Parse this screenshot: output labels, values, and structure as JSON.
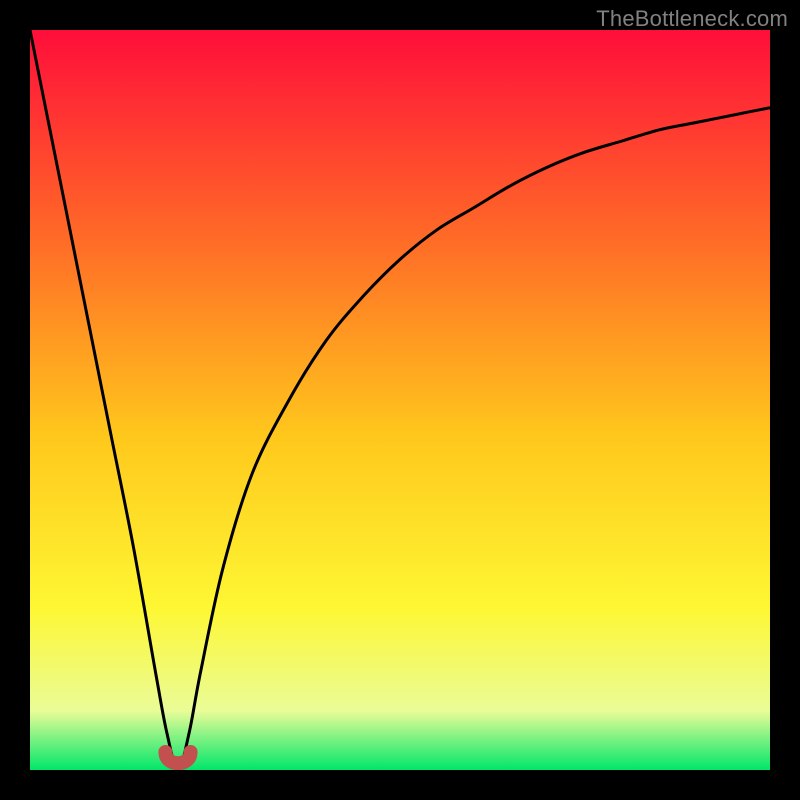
{
  "watermark": "TheBottleneck.com",
  "colors": {
    "frame": "#000000",
    "gradient_top": "#ff0e3a",
    "gradient_mid1": "#ff6a27",
    "gradient_mid2": "#ffc81c",
    "gradient_mid3": "#fef733",
    "gradient_mid4": "#eafc97",
    "gradient_bottom": "#00e66a",
    "curve": "#000000",
    "marker": "#c1504e"
  },
  "chart_data": {
    "type": "line",
    "title": "",
    "xlabel": "",
    "ylabel": "",
    "xlim": [
      0,
      100
    ],
    "ylim": [
      0,
      100
    ],
    "note": "Schematic bottleneck curve; y≈100 at x=0, sharp minimum ≈0 near x≈20, asymptote toward y≈90 as x→100.",
    "series": [
      {
        "name": "bottleneck-curve",
        "x": [
          0,
          2,
          5,
          8,
          11,
          14,
          17,
          18.5,
          20,
          21.5,
          23,
          26,
          30,
          35,
          40,
          45,
          50,
          55,
          60,
          65,
          70,
          75,
          80,
          85,
          90,
          95,
          100
        ],
        "values": [
          100,
          90,
          75,
          60,
          45,
          30,
          13,
          5,
          0,
          5,
          13,
          27,
          40,
          50,
          58,
          64,
          69,
          73,
          76,
          79,
          81.5,
          83.5,
          85,
          86.5,
          87.5,
          88.5,
          89.5
        ]
      }
    ],
    "minimum_marker": {
      "x_range": [
        18.3,
        21.7
      ],
      "y": 0
    }
  }
}
